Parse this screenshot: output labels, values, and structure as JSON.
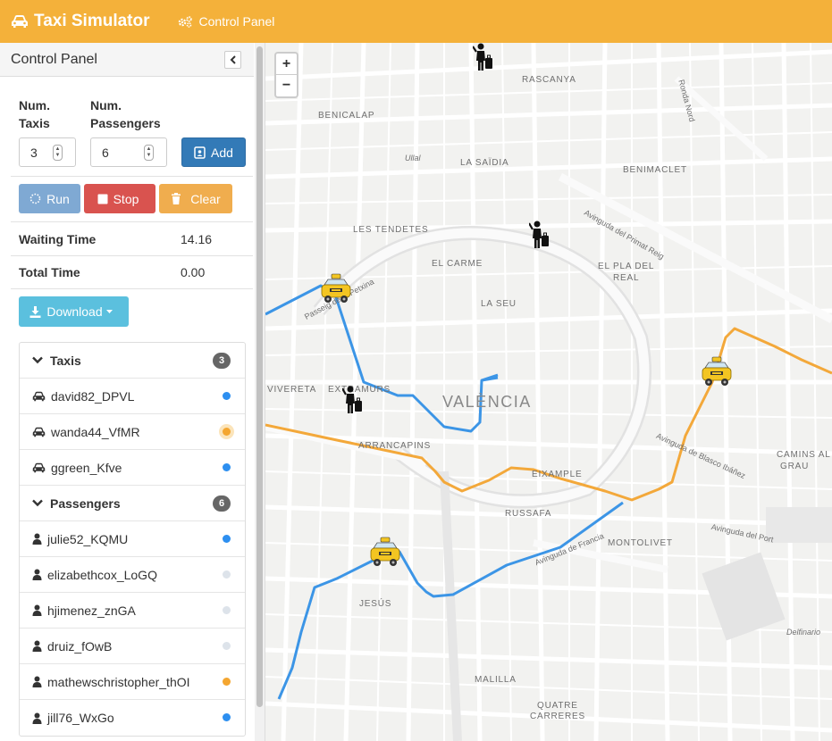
{
  "app": {
    "title": "Taxi Simulator",
    "nav_link": "Control Panel"
  },
  "panel": {
    "title": "Control Panel",
    "collapse_icon": "chevron-left-icon"
  },
  "form": {
    "taxis_label": "Num.\nTaxis",
    "taxis_label_1": "Num.",
    "taxis_label_2": "Taxis",
    "taxis_value": "3",
    "passengers_label_1": "Num.",
    "passengers_label_2": "Passengers",
    "passengers_value": "6",
    "add_label": "Add"
  },
  "actions": {
    "run": "Run",
    "stop": "Stop",
    "clear": "Clear",
    "download": "Download"
  },
  "stats": {
    "waiting_label": "Waiting Time",
    "waiting_value": "14.16",
    "total_label": "Total Time",
    "total_value": "0.00"
  },
  "taxis": {
    "label": "Taxis",
    "count": "3",
    "items": [
      {
        "name": "david82_DPVL",
        "status_color": "#2d8ff0"
      },
      {
        "name": "wanda44_VfMR",
        "status_color": "#f4a630"
      },
      {
        "name": "ggreen_Kfve",
        "status_color": "#2d8ff0"
      }
    ]
  },
  "passengers": {
    "label": "Passengers",
    "count": "6",
    "items": [
      {
        "name": "julie52_KQMU",
        "status_color": "#2d8ff0"
      },
      {
        "name": "elizabethcox_LoGQ",
        "status_color": "#dde3ea"
      },
      {
        "name": "hjimenez_znGA",
        "status_color": "#dde3ea"
      },
      {
        "name": "druiz_fOwB",
        "status_color": "#dde3ea"
      },
      {
        "name": "mathewschristopher_thOI",
        "status_color": "#f4a630"
      },
      {
        "name": "jill76_WxGo",
        "status_color": "#2d8ff0"
      }
    ]
  },
  "map": {
    "zoom_in": "+",
    "zoom_out": "−",
    "city": "VALÈNCIA",
    "labels": [
      "RASCANYA",
      "BENICALAP",
      "LA SAÏDIA",
      "BENIMACLET",
      "LES TENDETES",
      "EL CARME",
      "LA SEU",
      "EL PLA DEL",
      "REAL",
      "EXTRAMURS",
      "ARRANCAPINS",
      "EIXAMPLE",
      "RUSSAFA",
      "CAMINS AL",
      "GRAU",
      "MONTOLIVET",
      "JESÚS",
      "MALILLA",
      "QUATRE",
      "CARRERES",
      "Delfinario",
      "Avinguda del Primat Reig",
      "Avinguda de Blasco Ibáñez",
      "Ronda Nord",
      "Passeig de la Petxina",
      "Avinguda del Port",
      "Avinguda de Francia",
      "VIVERETA",
      "Ullal"
    ]
  },
  "colors": {
    "accent": "#f4b13a",
    "route_blue": "#3c95e6",
    "route_orange": "#f3a83a"
  }
}
